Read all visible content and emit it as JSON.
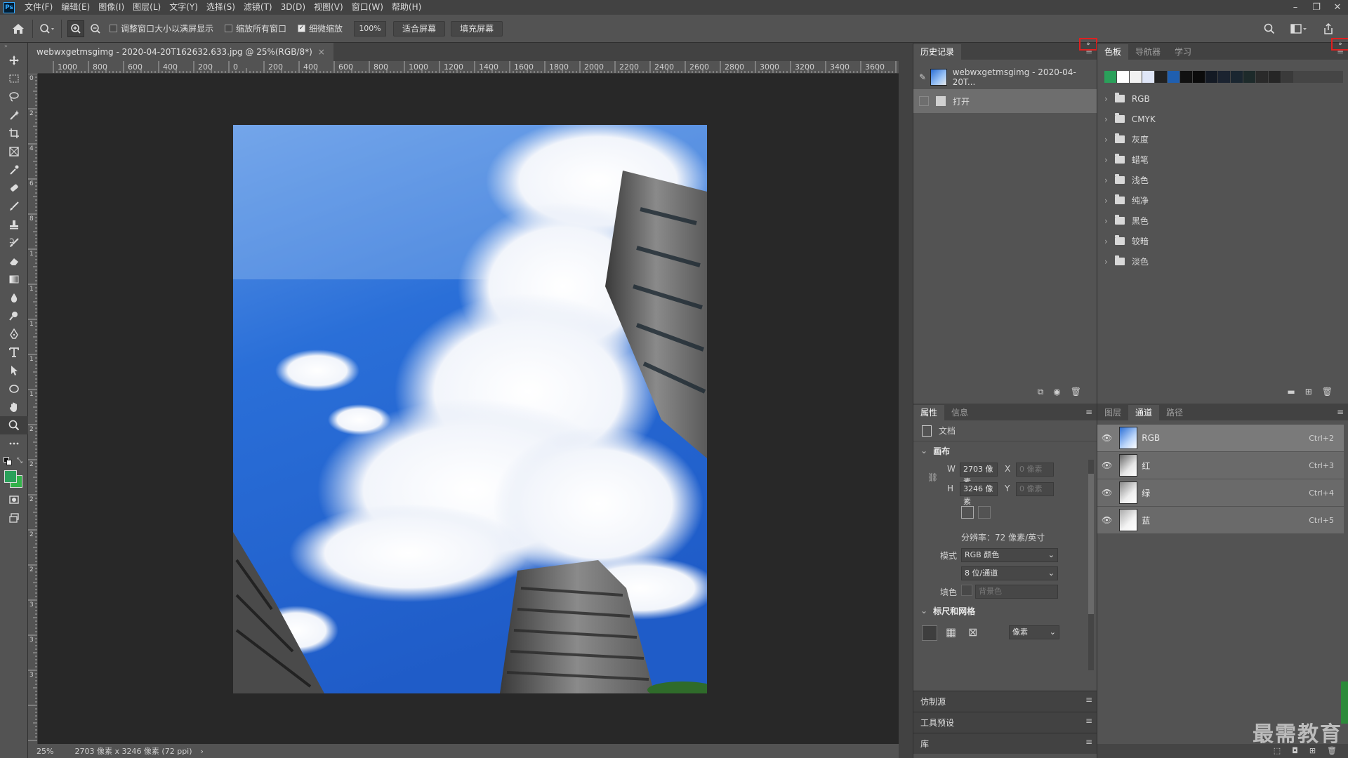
{
  "app": {
    "logo": "Ps"
  },
  "menubar": {
    "items": [
      "文件(F)",
      "编辑(E)",
      "图像(I)",
      "图层(L)",
      "文字(Y)",
      "选择(S)",
      "滤镜(T)",
      "3D(D)",
      "视图(V)",
      "窗口(W)",
      "帮助(H)"
    ]
  },
  "window_controls": {
    "minimize": "–",
    "restore": "❐",
    "close": "✕"
  },
  "options_bar": {
    "resize_windows_label": "调整窗口大小以满屏显示",
    "zoom_all_windows_label": "缩放所有窗口",
    "scrubby_zoom_label": "细微缩放",
    "zoom_value": "100%",
    "fit_screen_label": "适合屏幕",
    "fill_screen_label": "填充屏幕"
  },
  "document": {
    "tab_title": "webwxgetmsgimg - 2020-04-20T162632.633.jpg @ 25%(RGB/8*)",
    "close_glyph": "×"
  },
  "ruler_h": {
    "labels": [
      "1000",
      "800",
      "600",
      "400",
      "200",
      "0",
      "200",
      "400",
      "600",
      "800",
      "1000",
      "1200",
      "1400",
      "1600",
      "1800",
      "2000",
      "2200",
      "2400",
      "2600",
      "2800",
      "3000",
      "3200",
      "3400",
      "3600"
    ]
  },
  "ruler_v": {
    "labels": [
      "0",
      "2",
      "4",
      "6",
      "8",
      "1",
      "1",
      "1",
      "1",
      "1",
      "2",
      "2",
      "2",
      "2",
      "2",
      "3",
      "3",
      "3"
    ]
  },
  "status": {
    "zoom": "25%",
    "doc_info": "2703 像素 x 3246 像素 (72 ppi)",
    "arrow": "›"
  },
  "history_panel": {
    "tab": "历史记录",
    "snapshot_name": "webwxgetmsgimg - 2020-04-20T...",
    "step_label": "打开"
  },
  "swatches_panel": {
    "tabs": [
      "色板",
      "导航器",
      "学习"
    ],
    "recent_colors": [
      "#2aa05a",
      "#ffffff",
      "#f2f2f2",
      "#dfe6f7",
      "#222222",
      "#1f5fb0",
      "#111111",
      "#0b0b0b",
      "#141a24",
      "#1b2330",
      "#1a2630",
      "#1d2a2a",
      "#2a2a2a",
      "#262626",
      "#3a3a3a"
    ],
    "groups": [
      "RGB",
      "CMYK",
      "灰度",
      "蜡笔",
      "浅色",
      "纯净",
      "黑色",
      "较暗",
      "淡色"
    ]
  },
  "properties_panel": {
    "tabs": [
      "属性",
      "信息"
    ],
    "doc_label": "文档",
    "canvas_section": "画布",
    "w_label": "W",
    "w_value": "2703 像素",
    "x_label": "X",
    "x_placeholder": "0 像素",
    "h_label": "H",
    "h_value": "3246 像素",
    "y_label": "Y",
    "y_placeholder": "0 像素",
    "resolution": "分辨率：72 像素/英寸",
    "mode_label": "模式",
    "mode_value": "RGB 颜色",
    "depth_value": "8 位/通道",
    "fill_label": "填色",
    "fill_value": "背景色",
    "rulers_section": "标尺和网格",
    "unit_value": "像素"
  },
  "channels_panel": {
    "tabs": [
      "图层",
      "通道",
      "路径"
    ],
    "channels": [
      {
        "name": "RGB",
        "shortcut": "Ctrl+2"
      },
      {
        "name": "红",
        "shortcut": "Ctrl+3"
      },
      {
        "name": "绿",
        "shortcut": "Ctrl+4"
      },
      {
        "name": "蓝",
        "shortcut": "Ctrl+5"
      }
    ]
  },
  "collapsed_panels": [
    "仿制源",
    "工具预设",
    "库"
  ],
  "watermark": "最需教育",
  "colors": {
    "foreground": "#2aa05a",
    "background": "#33b24a",
    "accent_red": "#e02020"
  }
}
